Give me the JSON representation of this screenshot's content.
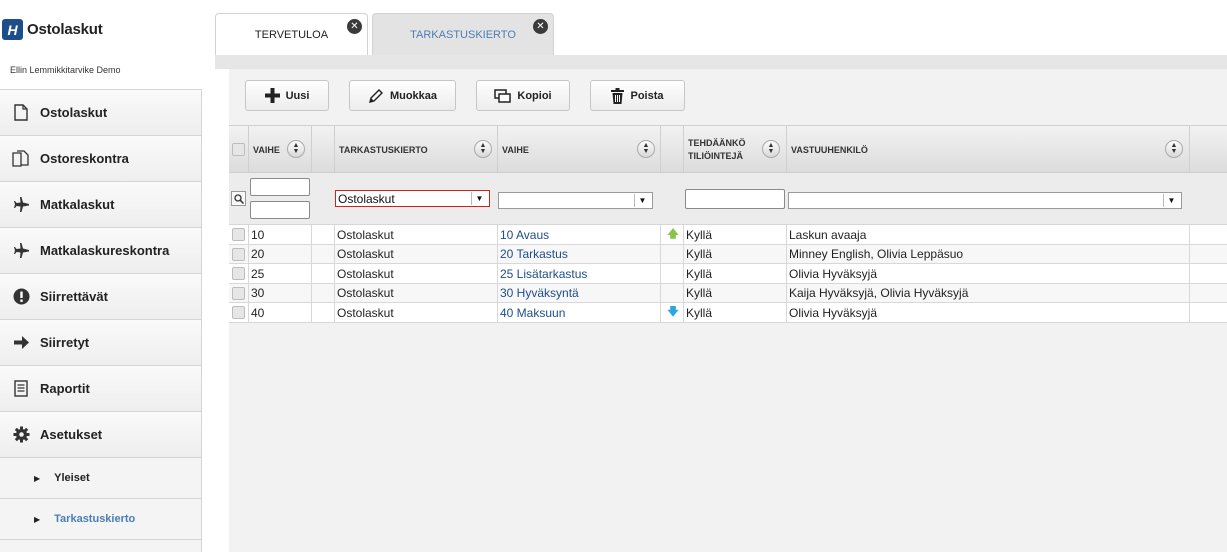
{
  "brand": {
    "logo_glyph": "H",
    "name": "Ostolaskut"
  },
  "company": "Ellin Lemmikkitarvike Demo",
  "sidebar": {
    "items": [
      {
        "label": "Ostolaskut",
        "icon": "document-icon"
      },
      {
        "label": "Ostoreskontra",
        "icon": "documents-icon"
      },
      {
        "label": "Matkalaskut",
        "icon": "airplane-icon"
      },
      {
        "label": "Matkalaskureskontra",
        "icon": "airplane-icon"
      },
      {
        "label": "Siirrettävät",
        "icon": "exclamation-icon"
      },
      {
        "label": "Siirretyt",
        "icon": "arrow-right-icon"
      },
      {
        "label": "Raportit",
        "icon": "report-icon"
      },
      {
        "label": "Asetukset",
        "icon": "gear-icon"
      }
    ],
    "subitems": [
      {
        "label": "Yleiset",
        "active": false
      },
      {
        "label": "Tarkastuskierto",
        "active": true
      }
    ]
  },
  "tabs": [
    {
      "label": "TERVETULOA",
      "active": false
    },
    {
      "label": "TARKASTUSKIERTO",
      "active": true
    }
  ],
  "toolbar": {
    "new_label": "Uusi",
    "edit_label": "Muokkaa",
    "copy_label": "Kopioi",
    "delete_label": "Poista"
  },
  "grid": {
    "columns": {
      "vaihe": "VAIHE",
      "tarkastuskierto": "TARKASTUSKIERTO",
      "vaihe2": "VAIHE",
      "tehdaanko_1": "TEHDÄÄNKÖ",
      "tehdaanko_2": "TILIÖINTEJÄ",
      "vastuuhenkilo": "VASTUUHENKILÖ"
    },
    "filters": {
      "tarkastuskierto_selected": "Ostolaskut",
      "vaihe_selected": "",
      "vastuuhenkilo_selected": ""
    },
    "rows": [
      {
        "vaihe": "10",
        "kierto": "Ostolaskut",
        "vaihe_name": "10 Avaus",
        "move": "up",
        "tiliointi": "Kyllä",
        "vastuu": "Laskun avaaja"
      },
      {
        "vaihe": "20",
        "kierto": "Ostolaskut",
        "vaihe_name": "20 Tarkastus",
        "move": "",
        "tiliointi": "Kyllä",
        "vastuu": "Minney English, Olivia Leppäsuo"
      },
      {
        "vaihe": "25",
        "kierto": "Ostolaskut",
        "vaihe_name": "25 Lisätarkastus",
        "move": "",
        "tiliointi": "Kyllä",
        "vastuu": "Olivia Hyväksyjä"
      },
      {
        "vaihe": "30",
        "kierto": "Ostolaskut",
        "vaihe_name": "30 Hyväksyntä",
        "move": "",
        "tiliointi": "Kyllä",
        "vastuu": "Kaija Hyväksyjä, Olivia Hyväksyjä"
      },
      {
        "vaihe": "40",
        "kierto": "Ostolaskut",
        "vaihe_name": "40 Maksuun",
        "move": "down",
        "tiliointi": "Kyllä",
        "vastuu": "Olivia Hyväksyjä"
      }
    ]
  },
  "colors": {
    "brand": "#1e4d8c",
    "active_link": "#4a7eb5",
    "filter_highlight": "#cc2222",
    "arrow_up": "#8bc34a",
    "arrow_down": "#29a8e0"
  }
}
